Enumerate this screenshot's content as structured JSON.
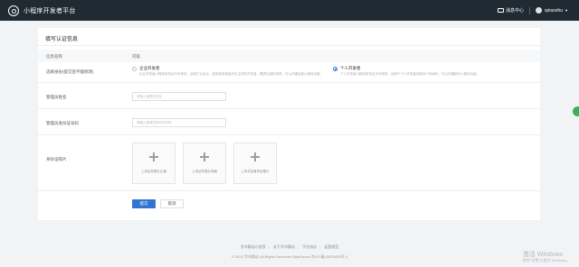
{
  "topbar": {
    "title": "小程序开发者平台",
    "messages_label": "消息中心",
    "username": "qxiaoshu"
  },
  "card": {
    "title": "填写认证信息",
    "header": {
      "col1": "信息名称",
      "col2": "内容"
    },
    "rows": {
      "identity": {
        "label": "选择身份(提交后不能修改)",
        "options": [
          {
            "title": "企业开发者",
            "desc": "企业开发者小程序发布后不可修改，适用于以企业、政府或其他组织为主体的开发者，需提交组织资质，可以开通全部小程序功能。"
          },
          {
            "title": "个人开发者",
            "desc": "个人开发者小程序发布后不可修改，适用于个人开发者或其他个体身份，可以开通部分小程序功能。"
          }
        ]
      },
      "name": {
        "label": "管理员姓名",
        "placeholder": "请输入管理员姓名"
      },
      "id_number": {
        "label": "管理员身份证号码",
        "placeholder": "请输入管理员身份证号码"
      },
      "photos": {
        "label": "身份证照片",
        "uploads": [
          "上传证件照片正面",
          "上传证件照片背面",
          "上传手持身份证照片"
        ]
      }
    },
    "buttons": {
      "submit": "提交",
      "cancel": "取消"
    }
  },
  "footer": {
    "links": [
      "字节跳动小程序",
      "关于字节跳动",
      "平台协议",
      "运营规范"
    ],
    "copyright": "© 2019 字节跳动 All Rights Reserved ByteDance 京ICP备12025439号-3"
  },
  "watermark": {
    "title": "激活 Windows",
    "desc": "转到\"设置\"以激活 Windows。"
  }
}
